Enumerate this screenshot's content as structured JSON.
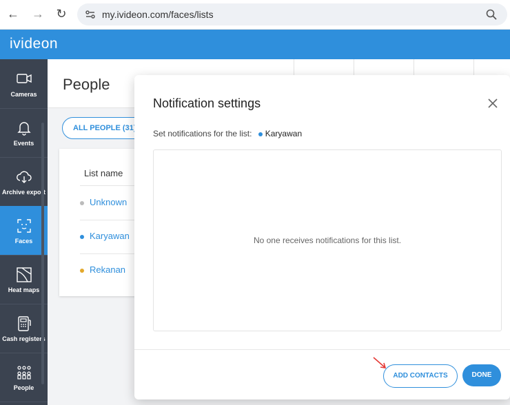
{
  "browser": {
    "url": "my.ivideon.com/faces/lists",
    "back_glyph": "←",
    "forward_glyph": "→",
    "reload_glyph": "↻"
  },
  "app": {
    "brand": "ivideon",
    "accent": "#2f8fdc"
  },
  "sidebar": {
    "items": [
      {
        "label": "Cameras",
        "icon": "camera-icon"
      },
      {
        "label": "Events",
        "icon": "bell-icon"
      },
      {
        "label": "Archive export",
        "icon": "cloud-download-icon"
      },
      {
        "label": "Faces",
        "icon": "face-icon",
        "active": true
      },
      {
        "label": "Heat maps",
        "icon": "heatmap-icon"
      },
      {
        "label": "Cash registers",
        "icon": "cash-register-icon"
      },
      {
        "label": "People",
        "icon": "people-icon"
      }
    ]
  },
  "page": {
    "title": "People",
    "all_people_button": "ALL PEOPLE (31)",
    "list_header": "List name",
    "lists": [
      {
        "name": "Unknown",
        "color": "#bbbbbb"
      },
      {
        "name": "Karyawan",
        "color": "#2f8fdc"
      },
      {
        "name": "Rekanan",
        "color": "#e3a82b"
      }
    ]
  },
  "modal": {
    "title": "Notification settings",
    "subtitle_prefix": "Set notifications for the list:",
    "list_name": "Karyawan",
    "list_color": "#2f8fdc",
    "empty_message": "No one receives notifications for this list.",
    "add_contacts_label": "ADD CONTACTS",
    "done_label": "DONE"
  }
}
